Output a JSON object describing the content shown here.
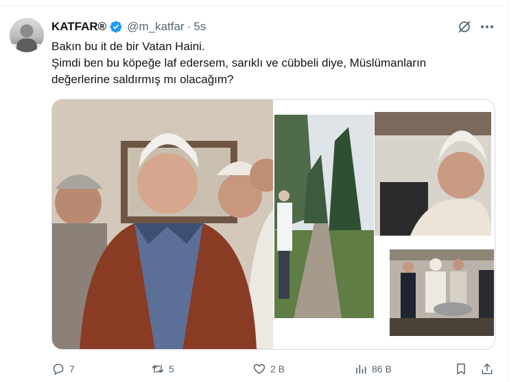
{
  "author": {
    "display_name": "KATFAR®",
    "handle": "@m_katfar",
    "time": "5s",
    "separator": "·"
  },
  "tweet": {
    "lines": [
      "Bakın bu it de bir Vatan Haini.",
      "Şimdi ben bu köpeğe laf edersem, sarıklı ve cübbeli diye, Müslümanların",
      "değerlerine saldırmış mı olacağım?"
    ]
  },
  "icons": {
    "verified": "verified-badge-icon",
    "grok": "grok-icon",
    "more": "more-icon",
    "reply": "reply-icon",
    "retweet": "retweet-icon",
    "like": "like-icon",
    "views": "views-icon",
    "bookmark": "bookmark-icon",
    "share": "share-icon"
  },
  "metrics": {
    "replies": "7",
    "retweets": "5",
    "likes": "2 B",
    "views": "86 B"
  },
  "colors": {
    "text": "#0f1419",
    "muted": "#536471",
    "verified": "#1d9bf0",
    "border": "#cfd9de"
  }
}
